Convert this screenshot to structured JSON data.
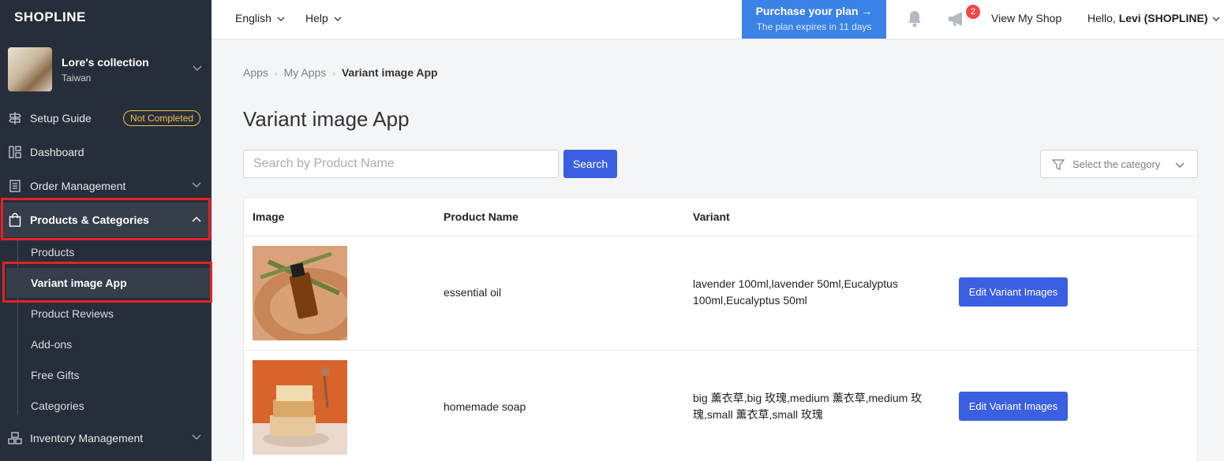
{
  "brand": {
    "logo": "SHOPLINE"
  },
  "shop": {
    "name": "Lore's collection",
    "region": "Taiwan"
  },
  "sidebar": {
    "setup_guide": "Setup Guide",
    "setup_badge": "Not Completed",
    "dashboard": "Dashboard",
    "order_management": "Order Management",
    "products_categories": "Products & Categories",
    "sub_items": [
      "Products",
      "Variant image App",
      "Product Reviews",
      "Add-ons",
      "Free Gifts",
      "Categories"
    ],
    "inventory_management": "Inventory Management"
  },
  "topbar": {
    "language": "English",
    "help": "Help",
    "purchase_title": "Purchase your plan →",
    "purchase_sub": "The plan expires in 11 days",
    "notif_count": "2",
    "view_shop": "View My Shop",
    "hello_prefix": "Hello,",
    "hello_user": "Levi (SHOPLINE)"
  },
  "breadcrumb": [
    "Apps",
    "My Apps",
    "Variant image App"
  ],
  "page_title": "Variant image App",
  "search": {
    "placeholder": "Search by Product Name",
    "button": "Search"
  },
  "category_select": {
    "placeholder": "Select the category"
  },
  "table": {
    "headers": [
      "Image",
      "Product Name",
      "Variant"
    ],
    "rows": [
      {
        "name": "essential oil",
        "variant": "lavender 100ml,lavender 50ml,Eucalyptus 100ml,Eucalyptus 50ml",
        "action": "Edit Variant Images"
      },
      {
        "name": "homemade soap",
        "variant": "big 薰衣草,big 玫瑰,medium 薰衣草,medium 玫瑰,small 薰衣草,small 玫瑰",
        "action": "Edit Variant Images"
      }
    ]
  },
  "colors": {
    "sidebar_bg": "#272e3b",
    "accent": "#3a5fe0",
    "purchase_bg": "#3b82e6",
    "highlight": "#e52222",
    "badge": "#f0c14b"
  }
}
